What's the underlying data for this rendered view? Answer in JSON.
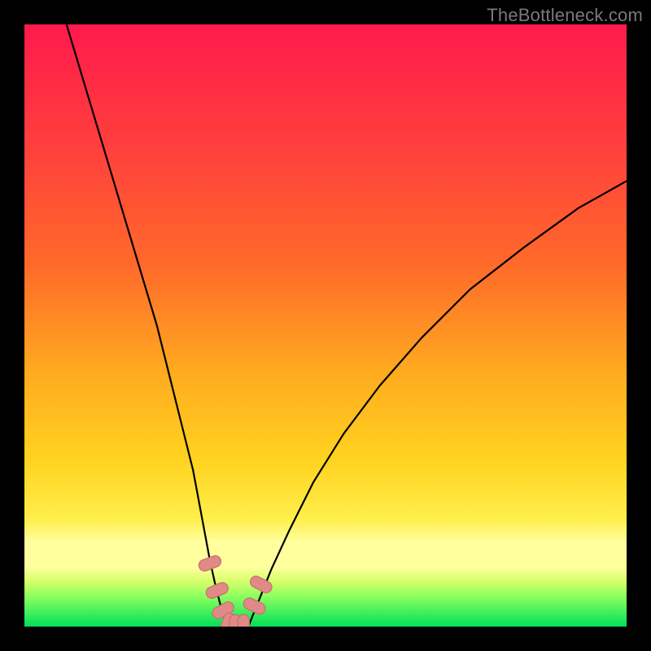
{
  "watermark": {
    "text": "TheBottleneck.com"
  },
  "colors": {
    "frame_bg": "#000000",
    "watermark_text": "#7a7a7a",
    "gradient_top": "#ff1a4c",
    "gradient_mid1": "#ff6a2a",
    "gradient_mid2": "#ffd21f",
    "gradient_band": "#ffff9e",
    "gradient_green": "#00e05a",
    "curve_stroke": "#000000",
    "marker_fill": "#e08a87",
    "marker_stroke": "#c96e6b"
  },
  "chart_data": {
    "type": "line",
    "title": "",
    "xlabel": "",
    "ylabel": "",
    "xlim": [
      0,
      100
    ],
    "ylim": [
      0,
      100
    ],
    "grid": false,
    "legend": false,
    "curve_left": {
      "x": [
        7,
        10,
        13,
        16,
        19,
        22,
        24,
        26,
        28,
        29.5,
        30.8,
        31.8,
        32.6,
        33.2,
        33.7
      ],
      "y": [
        100,
        90,
        80,
        70,
        60,
        50,
        42,
        34,
        26,
        18,
        11,
        6.5,
        3.4,
        1.4,
        0
      ]
    },
    "curve_right": {
      "x": [
        37.2,
        37.9,
        39,
        41,
        44,
        48,
        53,
        59,
        66,
        74,
        83,
        92,
        100
      ],
      "y": [
        0,
        1.8,
        4.5,
        9.5,
        16,
        24,
        32,
        40,
        48,
        56,
        63,
        69.5,
        74
      ]
    },
    "markers": [
      {
        "x": 30.8,
        "y": 10.5,
        "rot": 70
      },
      {
        "x": 32.0,
        "y": 6.0,
        "rot": 68
      },
      {
        "x": 33.0,
        "y": 2.7,
        "rot": 62
      },
      {
        "x": 33.7,
        "y": 0.4,
        "rot": 20
      },
      {
        "x": 35.0,
        "y": 0.1,
        "rot": 0
      },
      {
        "x": 36.4,
        "y": 0.1,
        "rot": 0
      },
      {
        "x": 38.2,
        "y": 3.4,
        "rot": -65
      },
      {
        "x": 39.3,
        "y": 7.0,
        "rot": -63
      }
    ]
  }
}
